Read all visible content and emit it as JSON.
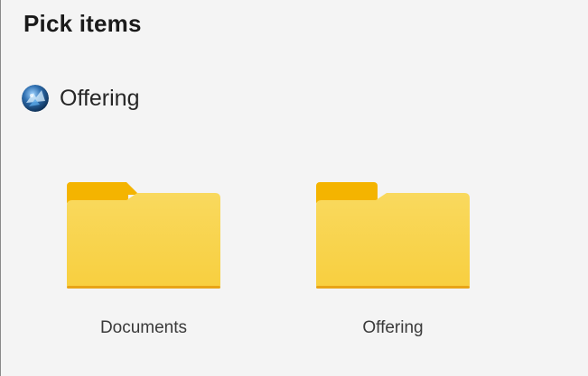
{
  "dialog": {
    "title": "Pick items"
  },
  "breadcrumb": {
    "label": "Offering",
    "avatar_icon": "account-avatar-icon"
  },
  "items": [
    {
      "name": "Documents",
      "icon": "folder-icon"
    },
    {
      "name": "Offering",
      "icon": "folder-icon"
    }
  ],
  "colors": {
    "background": "#f4f4f4",
    "folder_tab": "#f4b400",
    "folder_body_top": "#f9d95e",
    "folder_body_bottom": "#f8cf3f",
    "folder_edge": "#e8a417"
  }
}
